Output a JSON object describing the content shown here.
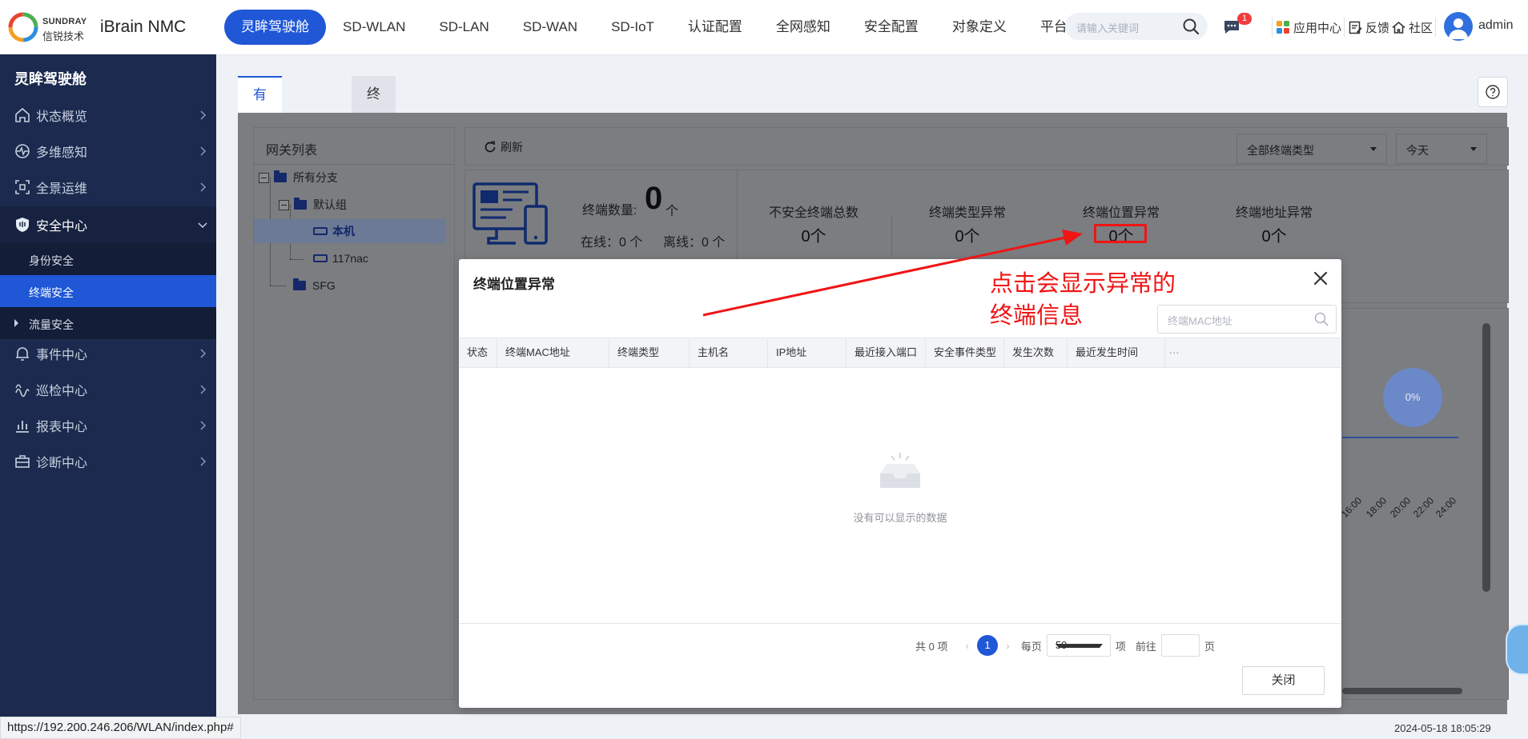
{
  "brand": {
    "en": "SUNDRAY",
    "cn": "信锐技术",
    "product": "iBrain NMC"
  },
  "nav": {
    "items": [
      "灵眸驾驶舱",
      "SD-WLAN",
      "SD-LAN",
      "SD-WAN",
      "SD-IoT",
      "认证配置",
      "全网感知",
      "安全配置",
      "对象定义",
      "平台管理"
    ],
    "active": "灵眸驾驶舱"
  },
  "search": {
    "placeholder": "请输入关键词"
  },
  "header": {
    "msg_badge": "1",
    "app_center": "应用中心",
    "feedback": "反馈",
    "community": "社区",
    "user": "admin"
  },
  "sidebar": {
    "title": "灵眸驾驶舱",
    "items": [
      {
        "label": "状态概览",
        "icon": "home-icon"
      },
      {
        "label": "多维感知",
        "icon": "pulse-icon"
      },
      {
        "label": "全景运维",
        "icon": "scan-icon"
      },
      {
        "label": "安全中心",
        "icon": "shield-icon"
      },
      {
        "label": "事件中心",
        "icon": "bell-icon"
      },
      {
        "label": "巡检中心",
        "icon": "wave-icon"
      },
      {
        "label": "报表中心",
        "icon": "bar-chart-icon"
      },
      {
        "label": "诊断中心",
        "icon": "toolbox-icon"
      }
    ],
    "sub_items": [
      "身份安全",
      "终端安全",
      "流量安全"
    ]
  },
  "tabs": [
    "有线终端安全",
    "终端黑名单"
  ],
  "gateway_list": {
    "title": "网关列表",
    "nodes": [
      "所有分支",
      "默认组",
      "本机",
      "117nac",
      "SFG"
    ]
  },
  "toolbar": {
    "refresh": "刷新",
    "type_filter": "全部终端类型",
    "time_filter": "今天"
  },
  "summary": {
    "count_label": "终端数量:",
    "count_value": "0",
    "count_unit": "个",
    "online": "在线：0 个",
    "offline": "离线：0 个",
    "stats": [
      {
        "title": "不安全终端总数",
        "value": "0个"
      },
      {
        "title": "终端类型异常",
        "value": "0个"
      },
      {
        "title": "终端位置异常",
        "value": "0个"
      },
      {
        "title": "终端地址异常",
        "value": "0个"
      }
    ]
  },
  "chart": {
    "donut_label": "0%",
    "ticks": [
      "16:00",
      "18:00",
      "20:00",
      "22:00",
      "24:00"
    ]
  },
  "dialog": {
    "title": "终端位置异常",
    "search_placeholder": "终端MAC地址",
    "columns": [
      "状态",
      "终端MAC地址",
      "终端类型",
      "主机名",
      "IP地址",
      "最近接入端口",
      "安全事件类型",
      "发生次数",
      "最近发生时间"
    ],
    "empty_text": "没有可以显示的数据",
    "pagination": {
      "total": "共 0 项",
      "current_page": "1",
      "per_page_label": "每页",
      "page_size": "50",
      "items_unit": "项",
      "goto_label": "前往",
      "page_unit": "页"
    },
    "close_button": "关闭"
  },
  "annotation": {
    "line1": "点击会显示异常的",
    "line2": "终端信息",
    "color": "#f01414"
  },
  "status": {
    "url": "https://192.200.246.206/WLAN/index.php#",
    "datetime": "2024-05-18 18:05:29"
  },
  "colors": {
    "primary": "#1f57d6",
    "sidebar_bg": "#1b2a4e",
    "badge": "#f03c3c"
  }
}
